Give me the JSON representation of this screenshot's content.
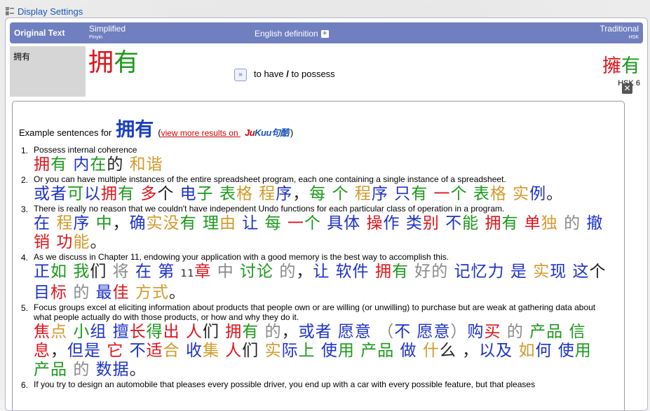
{
  "display_settings": {
    "label": "Display Settings",
    "icon": "settings-list-icon"
  },
  "header": {
    "original": "Original Text",
    "simplified": "Simplified",
    "simplified_sub": "Pinyin",
    "english": "English definition",
    "traditional": "Traditional",
    "traditional_sub": "HSK"
  },
  "entry": {
    "original": "拥有",
    "simplified_chars": [
      {
        "ch": "拥",
        "color": "#e0141b"
      },
      {
        "ch": "有",
        "color": "#1a9a1a"
      }
    ],
    "definition_a": "to have",
    "definition_sep": "/",
    "definition_b": "to possess",
    "traditional_chars": [
      {
        "ch": "擁",
        "color": "#e0141b"
      },
      {
        "ch": "有",
        "color": "#1a9a1a"
      }
    ],
    "hsk": "HSK 6"
  },
  "examples_header": {
    "prefix": "Example sentences for",
    "word": "拥有",
    "open_paren": "(",
    "link": "view more results on",
    "brand_j": "Ju",
    "brand_rest": "Kuu句酷",
    "close_paren": ")"
  },
  "colors": {
    "r": "#e0141b",
    "g": "#1a9a1a",
    "b": "#1d32c8",
    "o": "#d39a2c",
    "k": "#222222",
    "y": "#8a8a8a"
  },
  "examples": [
    {
      "num": "1.",
      "en": "Possess internal coherence",
      "zh": [
        [
          "拥",
          "r"
        ],
        [
          "有",
          "g"
        ],
        [
          " ",
          "k"
        ],
        [
          "内",
          "b"
        ],
        [
          "在",
          "g"
        ],
        [
          "的",
          "k"
        ],
        [
          " ",
          "k"
        ],
        [
          "和",
          "o"
        ],
        [
          "谐",
          "o"
        ]
      ]
    },
    {
      "num": "2.",
      "en": "Or you can have multiple instances of the entire spreadsheet program, each one containing a single instance of a spreadsheet.",
      "zh": [
        [
          "或",
          "b"
        ],
        [
          "者",
          "b"
        ],
        [
          "可",
          "g"
        ],
        [
          "以",
          "b"
        ],
        [
          "拥",
          "r"
        ],
        [
          "有",
          "g"
        ],
        [
          " ",
          "k"
        ],
        [
          "多",
          "r"
        ],
        [
          "个",
          "k"
        ],
        [
          " ",
          "k"
        ],
        [
          "电",
          "b"
        ],
        [
          "子",
          "g"
        ],
        [
          " ",
          "k"
        ],
        [
          "表",
          "g"
        ],
        [
          "格",
          "o"
        ],
        [
          " ",
          "k"
        ],
        [
          "程",
          "o"
        ],
        [
          "序",
          "b"
        ],
        [
          "，",
          "k"
        ],
        [
          "每",
          "g"
        ],
        [
          " ",
          "k"
        ],
        [
          "个",
          "g"
        ],
        [
          " ",
          "k"
        ],
        [
          "程",
          "o"
        ],
        [
          "序",
          "b"
        ],
        [
          " ",
          "k"
        ],
        [
          "只",
          "b"
        ],
        [
          "有",
          "g"
        ],
        [
          " ",
          "k"
        ],
        [
          "一",
          "r"
        ],
        [
          "个",
          "g"
        ],
        [
          " ",
          "k"
        ],
        [
          "表",
          "g"
        ],
        [
          "格",
          "o"
        ],
        [
          " ",
          "k"
        ],
        [
          "实",
          "o"
        ],
        [
          "例",
          "b"
        ],
        [
          "。",
          "k"
        ]
      ]
    },
    {
      "num": "3.",
      "en": "There is really no reason that we couldn't have independent Undo functions for each particular class of operation in a program.",
      "zh": [
        [
          "在",
          "b"
        ],
        [
          " ",
          "k"
        ],
        [
          "程",
          "o"
        ],
        [
          "序",
          "b"
        ],
        [
          " ",
          "k"
        ],
        [
          "中",
          "g"
        ],
        [
          "，",
          "k"
        ],
        [
          "确",
          "b"
        ],
        [
          "实",
          "o"
        ],
        [
          "没",
          "o"
        ],
        [
          "有",
          "g"
        ],
        [
          " ",
          "k"
        ],
        [
          "理",
          "g"
        ],
        [
          "由",
          "o"
        ],
        [
          " ",
          "k"
        ],
        [
          "让",
          "b"
        ],
        [
          " ",
          "k"
        ],
        [
          "每",
          "g"
        ],
        [
          " ",
          "k"
        ],
        [
          "一",
          "r"
        ],
        [
          "个",
          "g"
        ],
        [
          " ",
          "k"
        ],
        [
          "具",
          "b"
        ],
        [
          "体",
          "b"
        ],
        [
          " ",
          "k"
        ],
        [
          "操",
          "r"
        ],
        [
          "作",
          "b"
        ],
        [
          " ",
          "k"
        ],
        [
          "类",
          "b"
        ],
        [
          "别",
          "r"
        ],
        [
          " ",
          "k"
        ],
        [
          "不",
          "b"
        ],
        [
          "能",
          "g"
        ],
        [
          " ",
          "k"
        ],
        [
          "拥",
          "r"
        ],
        [
          "有",
          "g"
        ],
        [
          " ",
          "k"
        ],
        [
          "单",
          "r"
        ],
        [
          "独",
          "o"
        ],
        [
          " ",
          "k"
        ],
        [
          "的",
          "y"
        ],
        [
          " ",
          "k"
        ],
        [
          "撤",
          "b"
        ],
        [
          "销",
          "r"
        ],
        [
          " ",
          "k"
        ],
        [
          "功",
          "r"
        ],
        [
          "能",
          "o"
        ],
        [
          "。",
          "k"
        ]
      ]
    },
    {
      "num": "4.",
      "en": "As we discuss in Chapter 11, endowing your application with a good memory is the best way to accomplish this.",
      "zh": [
        [
          "正",
          "b"
        ],
        [
          "如",
          "g"
        ],
        [
          " ",
          "k"
        ],
        [
          "我",
          "g"
        ],
        [
          "们",
          "k"
        ],
        [
          " ",
          "k"
        ],
        [
          "将",
          "y"
        ],
        [
          " ",
          "k"
        ],
        [
          "在",
          "b"
        ],
        [
          " ",
          "k"
        ],
        [
          "第",
          "b"
        ],
        [
          " ",
          "k"
        ],
        [
          "11",
          "k"
        ],
        [
          "章",
          "r"
        ],
        [
          " ",
          "k"
        ],
        [
          "中",
          "y"
        ],
        [
          " ",
          "k"
        ],
        [
          "讨",
          "g"
        ],
        [
          "论",
          "g"
        ],
        [
          " ",
          "k"
        ],
        [
          "的",
          "y"
        ],
        [
          "，",
          "k"
        ],
        [
          "让",
          "b"
        ],
        [
          " ",
          "k"
        ],
        [
          "软",
          "b"
        ],
        [
          "件",
          "b"
        ],
        [
          " ",
          "k"
        ],
        [
          "拥",
          "r"
        ],
        [
          "有",
          "g"
        ],
        [
          " ",
          "k"
        ],
        [
          "好",
          "y"
        ],
        [
          "的",
          "y"
        ],
        [
          " ",
          "k"
        ],
        [
          "记",
          "b"
        ],
        [
          "忆",
          "b"
        ],
        [
          "力",
          "b"
        ],
        [
          " ",
          "k"
        ],
        [
          "是",
          "b"
        ],
        [
          " ",
          "k"
        ],
        [
          "实",
          "o"
        ],
        [
          "现",
          "b"
        ],
        [
          " ",
          "k"
        ],
        [
          "这",
          "b"
        ],
        [
          "个",
          "k"
        ],
        [
          " ",
          "k"
        ],
        [
          "目",
          "b"
        ],
        [
          "标",
          "r"
        ],
        [
          " ",
          "k"
        ],
        [
          "的",
          "y"
        ],
        [
          " ",
          "k"
        ],
        [
          "最",
          "b"
        ],
        [
          "佳",
          "r"
        ],
        [
          " ",
          "k"
        ],
        [
          "方",
          "o"
        ],
        [
          "式",
          "o"
        ],
        [
          "。",
          "k"
        ]
      ]
    },
    {
      "num": "5.",
      "en": "Focus groups excel at eliciting information about products that people own or are willing (or unwilling) to purchase but are weak at gathering data about what people actually do with those products, or how and why they do it.",
      "zh": [
        [
          "焦",
          "r"
        ],
        [
          "点",
          "o"
        ],
        [
          " ",
          "k"
        ],
        [
          "小",
          "g"
        ],
        [
          "组",
          "b"
        ],
        [
          " ",
          "k"
        ],
        [
          "擅",
          "b"
        ],
        [
          "长",
          "r"
        ],
        [
          "得",
          "g"
        ],
        [
          "出",
          "r"
        ],
        [
          " ",
          "k"
        ],
        [
          "人",
          "r"
        ],
        [
          "们",
          "k"
        ],
        [
          " ",
          "k"
        ],
        [
          "拥",
          "r"
        ],
        [
          "有",
          "g"
        ],
        [
          " ",
          "k"
        ],
        [
          "的",
          "y"
        ],
        [
          "，",
          "k"
        ],
        [
          "或",
          "b"
        ],
        [
          "者",
          "b"
        ],
        [
          " ",
          "k"
        ],
        [
          "愿",
          "b"
        ],
        [
          "意",
          "b"
        ],
        [
          " ",
          "k"
        ],
        [
          "（",
          "y"
        ],
        [
          "不",
          "b"
        ],
        [
          " ",
          "k"
        ],
        [
          "愿",
          "b"
        ],
        [
          "意",
          "b"
        ],
        [
          "）",
          "y"
        ],
        [
          "购",
          "b"
        ],
        [
          "买",
          "r"
        ],
        [
          " ",
          "k"
        ],
        [
          "的",
          "y"
        ],
        [
          " ",
          "k"
        ],
        [
          "产",
          "g"
        ],
        [
          "品",
          "g"
        ],
        [
          " ",
          "k"
        ],
        [
          "信",
          "g"
        ],
        [
          "息",
          "r"
        ],
        [
          "，",
          "k"
        ],
        [
          "但",
          "b"
        ],
        [
          "是",
          "b"
        ],
        [
          " ",
          "k"
        ],
        [
          "它",
          "r"
        ],
        [
          " ",
          "k"
        ],
        [
          "不",
          "b"
        ],
        [
          "适",
          "r"
        ],
        [
          "合",
          "o"
        ],
        [
          " ",
          "k"
        ],
        [
          "收",
          "b"
        ],
        [
          "集",
          "o"
        ],
        [
          " ",
          "k"
        ],
        [
          "人",
          "r"
        ],
        [
          "们",
          "k"
        ],
        [
          " ",
          "k"
        ],
        [
          "实",
          "o"
        ],
        [
          "际",
          "b"
        ],
        [
          "上",
          "g"
        ],
        [
          " ",
          "k"
        ],
        [
          "使",
          "b"
        ],
        [
          "用",
          "g"
        ],
        [
          " ",
          "k"
        ],
        [
          "产",
          "g"
        ],
        [
          "品",
          "g"
        ],
        [
          " ",
          "k"
        ],
        [
          "做",
          "b"
        ],
        [
          " ",
          "k"
        ],
        [
          "什",
          "o"
        ],
        [
          "么",
          "k"
        ],
        [
          " ",
          "k"
        ],
        [
          "，",
          "k"
        ],
        [
          "以",
          "b"
        ],
        [
          "及",
          "b"
        ],
        [
          " ",
          "k"
        ],
        [
          "如",
          "o"
        ],
        [
          "何",
          "b"
        ],
        [
          " ",
          "k"
        ],
        [
          "使",
          "b"
        ],
        [
          "用",
          "g"
        ],
        [
          " ",
          "k"
        ],
        [
          "产",
          "g"
        ],
        [
          "品",
          "g"
        ],
        [
          " ",
          "k"
        ],
        [
          "的",
          "y"
        ],
        [
          " ",
          "k"
        ],
        [
          "数",
          "b"
        ],
        [
          "据",
          "b"
        ],
        [
          "。",
          "k"
        ]
      ]
    },
    {
      "num": "6.",
      "en": "If you try to design an automobile that pleases every possible driver, you end up with a car with every possible feature, but that pleases",
      "zh": []
    }
  ]
}
